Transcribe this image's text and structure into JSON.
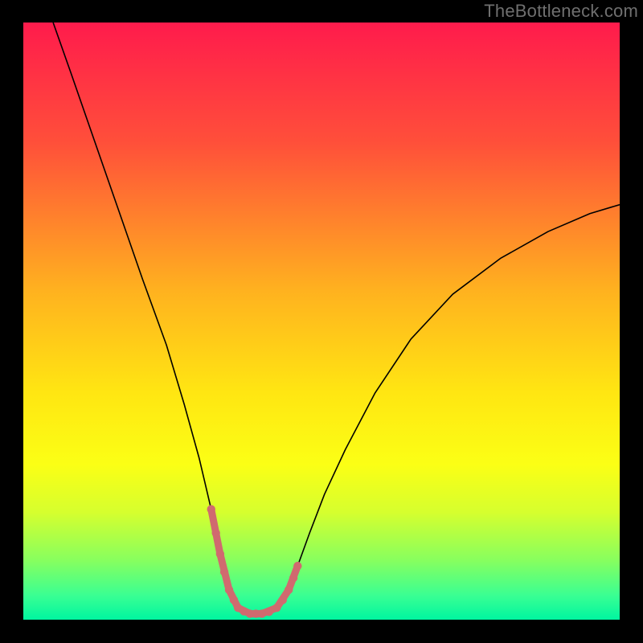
{
  "watermark": "TheBottleneck.com",
  "chart_data": {
    "type": "line",
    "title": "",
    "xlabel": "",
    "ylabel": "",
    "xlim": [
      0,
      100
    ],
    "ylim": [
      0,
      100
    ],
    "grid": false,
    "legend": false,
    "background_gradient": {
      "stops": [
        {
          "offset": 0,
          "color": "#ff1b4c"
        },
        {
          "offset": 0.2,
          "color": "#ff4f3a"
        },
        {
          "offset": 0.45,
          "color": "#ffb21f"
        },
        {
          "offset": 0.62,
          "color": "#ffe612"
        },
        {
          "offset": 0.74,
          "color": "#fbff15"
        },
        {
          "offset": 0.82,
          "color": "#d6ff2e"
        },
        {
          "offset": 0.9,
          "color": "#88ff5e"
        },
        {
          "offset": 0.96,
          "color": "#39ff93"
        },
        {
          "offset": 1.0,
          "color": "#00f5a0"
        }
      ]
    },
    "series": [
      {
        "name": "bottleneck-curve",
        "color": "#000000",
        "width": 1.6,
        "x": [
          5.0,
          8.0,
          12.0,
          16.0,
          20.0,
          24.0,
          27.0,
          29.5,
          31.5,
          33.0,
          34.5,
          36.0,
          38.0,
          40.0,
          42.5,
          44.5,
          46.0,
          48.0,
          50.5,
          54.0,
          59.0,
          65.0,
          72.0,
          80.0,
          88.0,
          95.0,
          100.0
        ],
        "y": [
          100.0,
          91.5,
          80.0,
          68.5,
          57.0,
          46.0,
          36.0,
          27.0,
          18.5,
          11.0,
          5.0,
          2.0,
          1.0,
          1.0,
          2.0,
          5.0,
          9.0,
          14.5,
          21.0,
          28.5,
          38.0,
          47.0,
          54.5,
          60.5,
          65.0,
          68.0,
          69.5
        ]
      },
      {
        "name": "valley-highlight",
        "color": "#d06a6f",
        "width": 9,
        "linecap": "round",
        "x": [
          31.5,
          33.0,
          34.5,
          36.0,
          38.0,
          40.0,
          42.5,
          44.5,
          46.0
        ],
        "y": [
          18.5,
          11.0,
          5.0,
          2.0,
          1.0,
          1.0,
          2.0,
          5.0,
          9.0
        ]
      }
    ],
    "valley_dots": {
      "color": "#d06a6f",
      "radius": 5.2,
      "points": [
        {
          "x": 31.5,
          "y": 18.5
        },
        {
          "x": 32.3,
          "y": 14.5
        },
        {
          "x": 33.0,
          "y": 11.0
        },
        {
          "x": 33.7,
          "y": 8.0
        },
        {
          "x": 34.5,
          "y": 5.0
        },
        {
          "x": 35.3,
          "y": 3.3
        },
        {
          "x": 36.0,
          "y": 2.0
        },
        {
          "x": 37.0,
          "y": 1.4
        },
        {
          "x": 38.0,
          "y": 1.0
        },
        {
          "x": 39.0,
          "y": 1.0
        },
        {
          "x": 40.0,
          "y": 1.0
        },
        {
          "x": 41.2,
          "y": 1.3
        },
        {
          "x": 42.5,
          "y": 2.0
        },
        {
          "x": 43.5,
          "y": 3.3
        },
        {
          "x": 44.5,
          "y": 5.0
        },
        {
          "x": 45.3,
          "y": 7.0
        },
        {
          "x": 46.0,
          "y": 9.0
        }
      ]
    }
  }
}
